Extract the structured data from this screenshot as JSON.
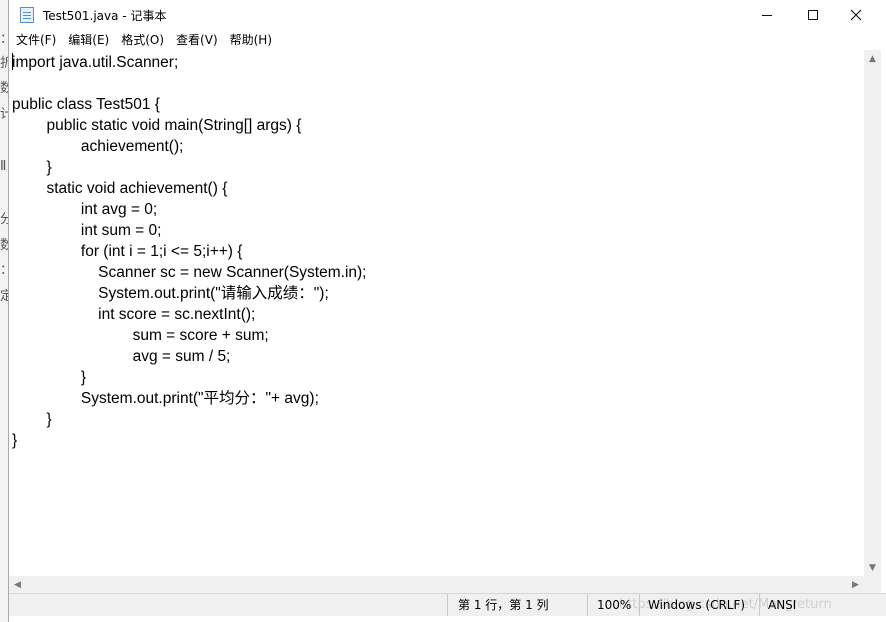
{
  "window": {
    "title": "Test501.java - 记事本",
    "icon": "notepad-icon",
    "controls": {
      "minimize": "minimize-icon",
      "maximize": "maximize-icon",
      "close": "close-icon"
    }
  },
  "menu": {
    "items": [
      "文件(F)",
      "编辑(E)",
      "格式(O)",
      "查看(V)",
      "帮助(H)"
    ]
  },
  "editor": {
    "content": "import java.util.Scanner;\n\npublic class Test501 {\n\tpublic static void main(String[] args) {\n\t\tachievement();\n\t}\n\tstatic void achievement() {\n\t\tint avg = 0;\n\t\tint sum = 0;\n\t\tfor (int i = 1;i <= 5;i++) {\n\t\t    Scanner sc = new Scanner(System.in);\n\t\t    System.out.print(\"请输入成绩：\");\n\t\t    int score = sc.nextInt();\n\t\t\t    sum = score + sum;\n\t\t\t    avg = sum / 5;\n\t\t}\n\t\tSystem.out.print(\"平均分：\"+ avg);\n\t}\n}"
  },
  "statusbar": {
    "position": "第 1 行，第 1 列",
    "zoom": "100%",
    "line_ending": "Windows (CRLF)",
    "encoding": "ANSI"
  },
  "watermark": "https://blog.csdn.net/Man_return",
  "background_window": {
    "glyphs": [
      "：",
      "折",
      "数",
      "计",
      "Ⅱ",
      "分",
      "数",
      "：",
      "定"
    ]
  }
}
